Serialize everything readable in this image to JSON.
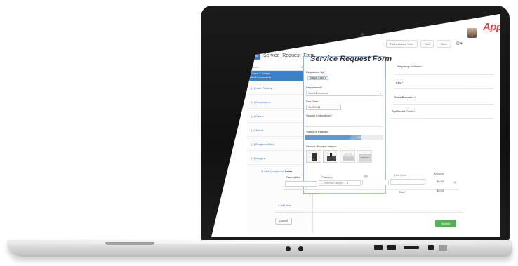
{
  "header": {
    "buttons": [
      "Performance View",
      "Test",
      "Save"
    ],
    "brand": "Appian"
  },
  "designer": {
    "form_name": "Service_Request_Form",
    "sidebar_head_left": "▾ Item 1",
    "sidebar_head_right": "Section",
    "sidebar_selected": [
      "Column 1: Column",
      "List of Components"
    ],
    "sidebar_items": [
      "(+) User Picker ▸",
      "(+) Dropdown ▸",
      "(+) Date ▸",
      "(+) Text ▸",
      "(+) Progress Bar ▸",
      "(+) Image ▸"
    ],
    "add_component": "⊕ Add Component"
  },
  "form": {
    "title": "Service Request Form",
    "requested_by_label": "Requested By",
    "requested_by_value": "Joseph Clark",
    "department_label": "Department",
    "department_placeholder": "Select Department",
    "due_date_label": "Due Date",
    "due_date_value": "01/22/2012",
    "special_instructions_label": "Special Instructions",
    "status_label": "Status of Request",
    "status_percent": "73%",
    "status_value": 0.73,
    "images_label": "Service Request Images",
    "shipping_address_label": "Shipping Address",
    "city_label": "City",
    "state_label": "State/Province",
    "zip_label": "Zip/Postal Code",
    "required_mark": "*"
  },
  "items": {
    "section_label": "Items",
    "columns": {
      "description": "Description",
      "category": "Category",
      "qty": "Qty",
      "unit_price": "Unit Price",
      "amount": "Amount"
    },
    "category_placeholder": "--- Select a Category --- ▾",
    "row_amount": "$0.00",
    "total_label": "Total",
    "total_value": "$0.00",
    "add_item": "+ Add Item"
  },
  "actions": {
    "cancel": "Cancel",
    "submit": "Submit"
  },
  "colors": {
    "accent_blue": "#3b7fc5",
    "submit_green": "#4aa84a",
    "brand_red": "#e32227"
  }
}
